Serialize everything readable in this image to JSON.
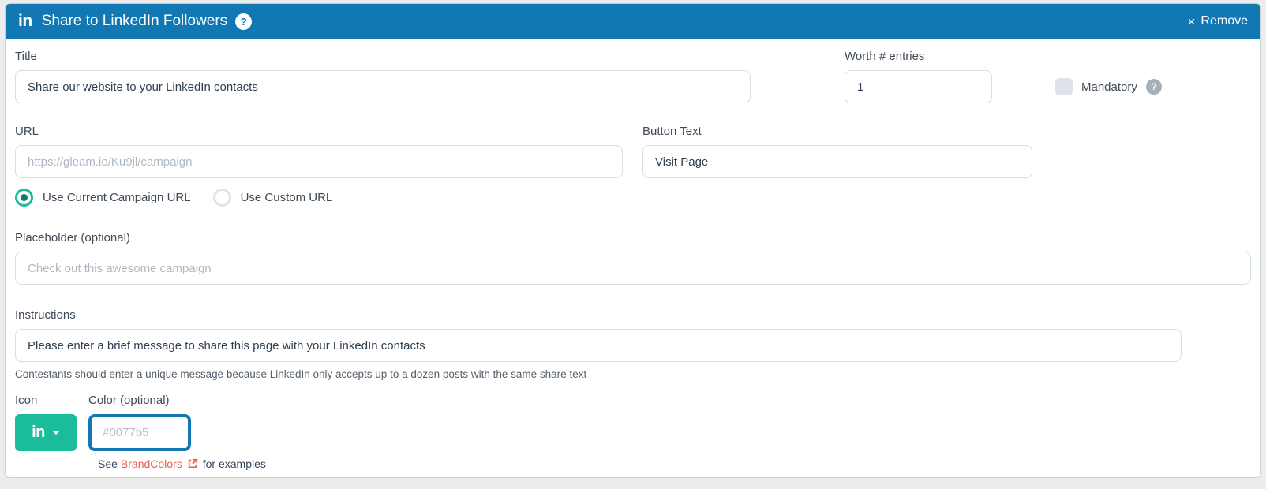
{
  "header": {
    "linkedin_glyph": "in",
    "title": "Share to LinkedIn Followers",
    "help_glyph": "?",
    "remove_x": "×",
    "remove_label": "Remove"
  },
  "fields": {
    "title": {
      "label": "Title",
      "value": "Share our website to your LinkedIn contacts"
    },
    "worth": {
      "label": "Worth # entries",
      "value": "1"
    },
    "mandatory": {
      "label": "Mandatory",
      "checked": false,
      "help_glyph": "?"
    },
    "url": {
      "label": "URL",
      "value": "",
      "placeholder": "https://gleam.io/Ku9jl/campaign"
    },
    "button_text": {
      "label": "Button Text",
      "value": "Visit Page"
    },
    "url_mode": {
      "options": [
        {
          "label": "Use Current Campaign URL",
          "selected": true
        },
        {
          "label": "Use Custom URL",
          "selected": false
        }
      ]
    },
    "placeholder": {
      "label": "Placeholder (optional)",
      "value": "",
      "placeholder": "Check out this awesome campaign"
    },
    "instructions": {
      "label": "Instructions",
      "value": "Please enter a brief message to share this page with your LinkedIn contacts",
      "helper": "Contestants should enter a unique message because LinkedIn only accepts up to a dozen posts with the same share text"
    },
    "icon": {
      "label": "Icon",
      "button_glyph": "in"
    },
    "color": {
      "label": "Color (optional)",
      "value": "",
      "placeholder": "#0077b5"
    },
    "brandcolors": {
      "prefix": "See",
      "link": "BrandColors",
      "suffix": "for examples"
    }
  },
  "colors": {
    "header_bg": "#1178b3",
    "accent_teal": "#1abc9c",
    "link_orange": "#e8604c",
    "focus_border_blue": "#1178b3"
  }
}
